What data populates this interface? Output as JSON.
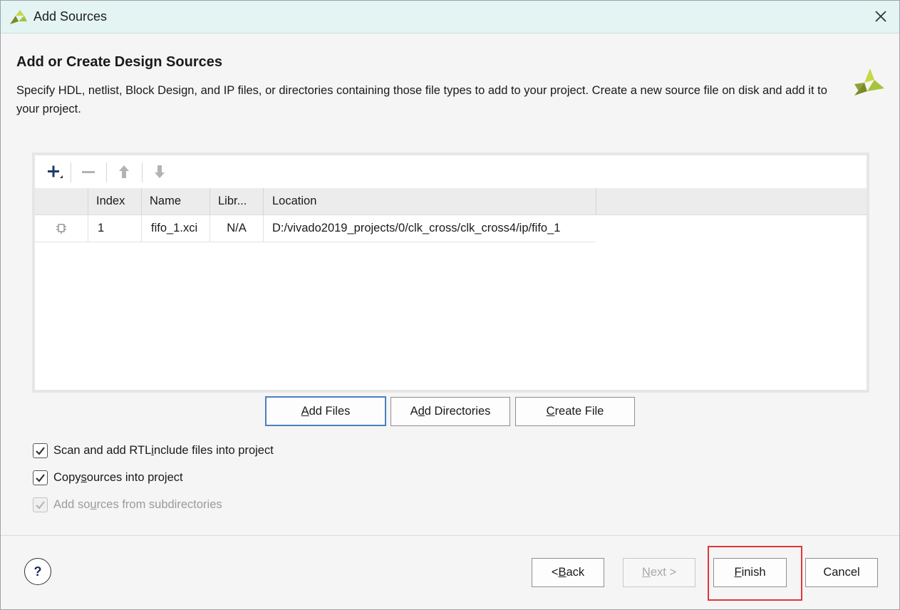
{
  "window": {
    "title": "Add Sources",
    "close_label": "Close"
  },
  "header": {
    "title": "Add or Create Design Sources",
    "description": "Specify HDL, netlist, Block Design, and IP files, or directories containing those file types to add to your project. Create a new source file on disk and add it to your project."
  },
  "toolbar": {
    "add_icon": "plus-icon",
    "remove_icon": "minus-icon",
    "up_icon": "arrow-up-icon",
    "down_icon": "arrow-down-icon"
  },
  "table": {
    "columns": [
      "Index",
      "Name",
      "Libr...",
      "Location"
    ],
    "rows": [
      {
        "icon": "ip-core-icon",
        "index": "1",
        "name": "fifo_1.xci",
        "library": "N/A",
        "location": "D:/vivado2019_projects/0/clk_cross/clk_cross4/ip/fifo_1"
      }
    ]
  },
  "buttons": {
    "add_files": {
      "mnemonic": "A",
      "rest": "dd Files"
    },
    "add_directories": {
      "pre": "A",
      "mnemonic": "d",
      "rest": "d Directories"
    },
    "create_file": {
      "mnemonic": "C",
      "rest": "reate File"
    }
  },
  "options": {
    "scan_rtl": {
      "pre": "Scan and add RTL ",
      "mnemonic": "i",
      "rest": "nclude files into project",
      "checked": true
    },
    "copy_sources": {
      "pre": "Copy ",
      "mnemonic": "s",
      "rest": "ources into project",
      "checked": true
    },
    "subdirectories": {
      "pre": "Add so",
      "mnemonic": "u",
      "rest": "rces from subdirectories",
      "checked": true,
      "disabled": true
    }
  },
  "footer": {
    "help": "?",
    "back": {
      "pre": "< ",
      "mnemonic": "B",
      "rest": "ack"
    },
    "next": {
      "mnemonic": "N",
      "rest": "ext >"
    },
    "finish": {
      "mnemonic": "F",
      "rest": "inish"
    },
    "cancel": "Cancel"
  },
  "colors": {
    "title_bar": "#e3f4f3",
    "primary_border": "#4a7fc1",
    "highlight": "#e0373b",
    "logo_green": "#a5c43a",
    "logo_dark": "#7b8a26"
  }
}
